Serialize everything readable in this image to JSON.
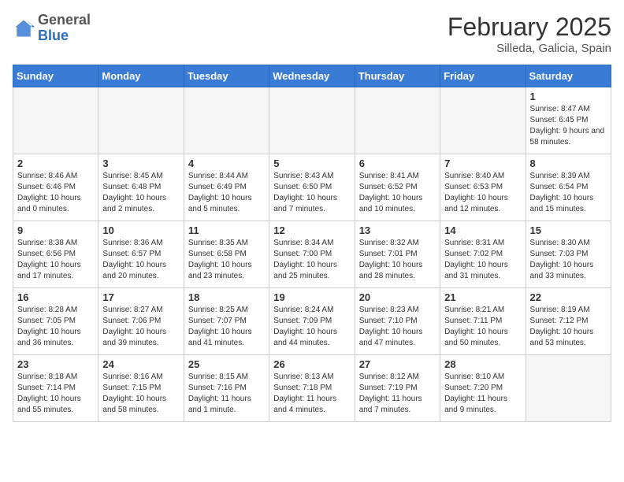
{
  "header": {
    "logo": {
      "general": "General",
      "blue": "Blue"
    },
    "title": "February 2025",
    "subtitle": "Silleda, Galicia, Spain"
  },
  "weekdays": [
    "Sunday",
    "Monday",
    "Tuesday",
    "Wednesday",
    "Thursday",
    "Friday",
    "Saturday"
  ],
  "weeks": [
    [
      {
        "day": "",
        "info": ""
      },
      {
        "day": "",
        "info": ""
      },
      {
        "day": "",
        "info": ""
      },
      {
        "day": "",
        "info": ""
      },
      {
        "day": "",
        "info": ""
      },
      {
        "day": "",
        "info": ""
      },
      {
        "day": "1",
        "info": "Sunrise: 8:47 AM\nSunset: 6:45 PM\nDaylight: 9 hours and 58 minutes."
      }
    ],
    [
      {
        "day": "2",
        "info": "Sunrise: 8:46 AM\nSunset: 6:46 PM\nDaylight: 10 hours and 0 minutes."
      },
      {
        "day": "3",
        "info": "Sunrise: 8:45 AM\nSunset: 6:48 PM\nDaylight: 10 hours and 2 minutes."
      },
      {
        "day": "4",
        "info": "Sunrise: 8:44 AM\nSunset: 6:49 PM\nDaylight: 10 hours and 5 minutes."
      },
      {
        "day": "5",
        "info": "Sunrise: 8:43 AM\nSunset: 6:50 PM\nDaylight: 10 hours and 7 minutes."
      },
      {
        "day": "6",
        "info": "Sunrise: 8:41 AM\nSunset: 6:52 PM\nDaylight: 10 hours and 10 minutes."
      },
      {
        "day": "7",
        "info": "Sunrise: 8:40 AM\nSunset: 6:53 PM\nDaylight: 10 hours and 12 minutes."
      },
      {
        "day": "8",
        "info": "Sunrise: 8:39 AM\nSunset: 6:54 PM\nDaylight: 10 hours and 15 minutes."
      }
    ],
    [
      {
        "day": "9",
        "info": "Sunrise: 8:38 AM\nSunset: 6:56 PM\nDaylight: 10 hours and 17 minutes."
      },
      {
        "day": "10",
        "info": "Sunrise: 8:36 AM\nSunset: 6:57 PM\nDaylight: 10 hours and 20 minutes."
      },
      {
        "day": "11",
        "info": "Sunrise: 8:35 AM\nSunset: 6:58 PM\nDaylight: 10 hours and 23 minutes."
      },
      {
        "day": "12",
        "info": "Sunrise: 8:34 AM\nSunset: 7:00 PM\nDaylight: 10 hours and 25 minutes."
      },
      {
        "day": "13",
        "info": "Sunrise: 8:32 AM\nSunset: 7:01 PM\nDaylight: 10 hours and 28 minutes."
      },
      {
        "day": "14",
        "info": "Sunrise: 8:31 AM\nSunset: 7:02 PM\nDaylight: 10 hours and 31 minutes."
      },
      {
        "day": "15",
        "info": "Sunrise: 8:30 AM\nSunset: 7:03 PM\nDaylight: 10 hours and 33 minutes."
      }
    ],
    [
      {
        "day": "16",
        "info": "Sunrise: 8:28 AM\nSunset: 7:05 PM\nDaylight: 10 hours and 36 minutes."
      },
      {
        "day": "17",
        "info": "Sunrise: 8:27 AM\nSunset: 7:06 PM\nDaylight: 10 hours and 39 minutes."
      },
      {
        "day": "18",
        "info": "Sunrise: 8:25 AM\nSunset: 7:07 PM\nDaylight: 10 hours and 41 minutes."
      },
      {
        "day": "19",
        "info": "Sunrise: 8:24 AM\nSunset: 7:09 PM\nDaylight: 10 hours and 44 minutes."
      },
      {
        "day": "20",
        "info": "Sunrise: 8:23 AM\nSunset: 7:10 PM\nDaylight: 10 hours and 47 minutes."
      },
      {
        "day": "21",
        "info": "Sunrise: 8:21 AM\nSunset: 7:11 PM\nDaylight: 10 hours and 50 minutes."
      },
      {
        "day": "22",
        "info": "Sunrise: 8:19 AM\nSunset: 7:12 PM\nDaylight: 10 hours and 53 minutes."
      }
    ],
    [
      {
        "day": "23",
        "info": "Sunrise: 8:18 AM\nSunset: 7:14 PM\nDaylight: 10 hours and 55 minutes."
      },
      {
        "day": "24",
        "info": "Sunrise: 8:16 AM\nSunset: 7:15 PM\nDaylight: 10 hours and 58 minutes."
      },
      {
        "day": "25",
        "info": "Sunrise: 8:15 AM\nSunset: 7:16 PM\nDaylight: 11 hours and 1 minute."
      },
      {
        "day": "26",
        "info": "Sunrise: 8:13 AM\nSunset: 7:18 PM\nDaylight: 11 hours and 4 minutes."
      },
      {
        "day": "27",
        "info": "Sunrise: 8:12 AM\nSunset: 7:19 PM\nDaylight: 11 hours and 7 minutes."
      },
      {
        "day": "28",
        "info": "Sunrise: 8:10 AM\nSunset: 7:20 PM\nDaylight: 11 hours and 9 minutes."
      },
      {
        "day": "",
        "info": ""
      }
    ]
  ]
}
